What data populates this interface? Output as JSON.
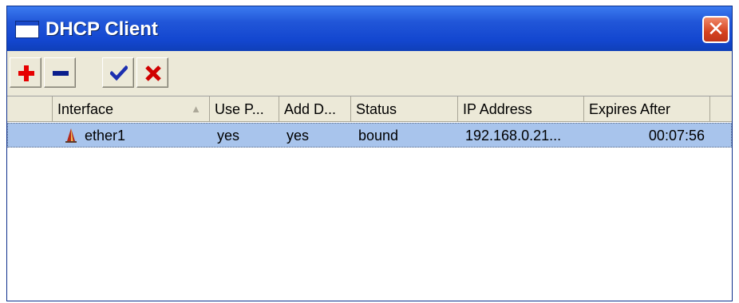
{
  "window": {
    "title": "DHCP Client",
    "close_glyph": "✕"
  },
  "toolbar": {
    "add": {
      "icon": "plus-icon",
      "color": "#e60000"
    },
    "remove": {
      "icon": "minus-icon",
      "color": "#0a1e8c"
    },
    "enable": {
      "icon": "checkmark-icon",
      "color": "#1c2fb0"
    },
    "disable": {
      "icon": "x-mark-icon",
      "color": "#d00000"
    }
  },
  "table": {
    "columns": [
      "",
      "Interface",
      "Use P...",
      "Add D...",
      "Status",
      "IP Address",
      "Expires After"
    ],
    "sort_indicator": "▲",
    "rows": [
      {
        "interface": "ether1",
        "use_peer": "yes",
        "add_default": "yes",
        "status": "bound",
        "ip_address": "192.168.0.21...",
        "expires_after": "00:07:56",
        "icon": "ethernet-interface-icon"
      }
    ],
    "selected_row_color": "#a8c4ec"
  }
}
